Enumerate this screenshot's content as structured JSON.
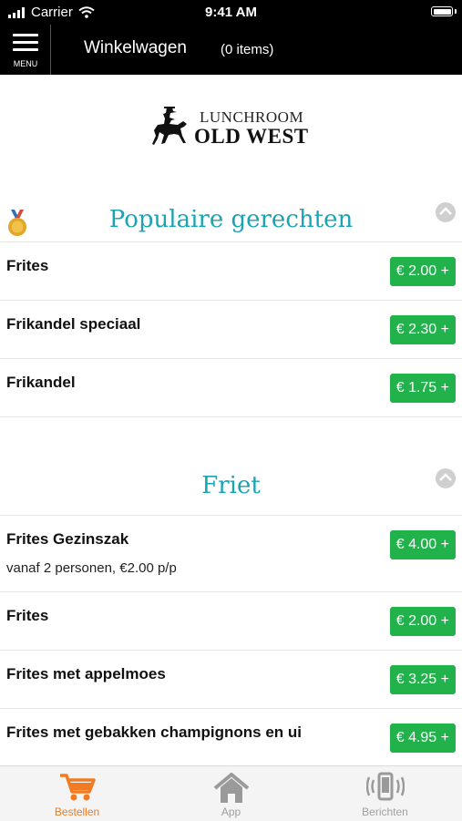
{
  "status_bar": {
    "carrier": "Carrier",
    "time": "9:41 AM"
  },
  "header": {
    "menu_label": "MENU",
    "title": "Winkelwagen",
    "item_count": "(0 items)"
  },
  "logo": {
    "line1": "LUNCHROOM",
    "line2": "OLD WEST"
  },
  "sections": [
    {
      "title": "Populaire gerechten",
      "items": [
        {
          "name": "Frites",
          "price": "€ 2.00 +"
        },
        {
          "name": "Frikandel speciaal",
          "price": "€ 2.30 +"
        },
        {
          "name": "Frikandel",
          "price": "€ 1.75 +"
        }
      ]
    },
    {
      "title": "Friet",
      "items": [
        {
          "name": "Frites Gezinszak",
          "description": "vanaf 2 personen, €2.00 p/p",
          "price": "€ 4.00 +"
        },
        {
          "name": "Frites",
          "price": "€ 2.00 +"
        },
        {
          "name": "Frites met appelmoes",
          "price": "€ 3.25 +"
        },
        {
          "name": "Frites met gebakken champignons en ui",
          "price": "€ 4.95 +"
        }
      ]
    }
  ],
  "tabs": [
    {
      "label": "Bestellen",
      "icon": "cart-icon",
      "active": true
    },
    {
      "label": "App",
      "icon": "home-icon",
      "active": false
    },
    {
      "label": "Berichten",
      "icon": "phone-vibrate-icon",
      "active": false
    }
  ],
  "colors": {
    "accent": "#1aa3b5",
    "price_button": "#22b24c",
    "active_tab": "#f07b22",
    "inactive_tab": "#a0a0a0"
  }
}
